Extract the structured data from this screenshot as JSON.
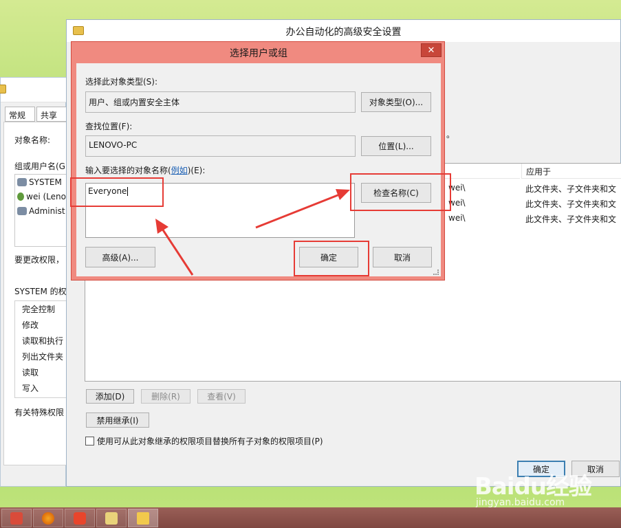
{
  "background_window": {
    "tabs": [
      "常规",
      "共享"
    ],
    "object_name_label": "对象名称:",
    "groups_label": "组或用户名(G",
    "users": [
      "SYSTEM",
      "wei (Leno",
      "Administ"
    ],
    "change_perm_text": "要更改权限，",
    "perm_header": "SYSTEM 的权",
    "permissions": [
      "完全控制",
      "修改",
      "读取和执行",
      "列出文件夹",
      "读取",
      "写入"
    ],
    "special_text": "有关特殊权限"
  },
  "main_window": {
    "title": "办公自动化的高级安全设置",
    "col_applies_to": "应用于",
    "rows": [
      {
        "principal": "wei\\",
        "applies": "此文件夹、子文件夹和文"
      },
      {
        "principal": "wei\\",
        "applies": "此文件夹、子文件夹和文"
      },
      {
        "principal": "wei\\",
        "applies": "此文件夹、子文件夹和文"
      }
    ],
    "dot_text": "。",
    "add_label": "添加(D)",
    "remove_label": "删除(R)",
    "view_label": "查看(V)",
    "disable_inherit_label": "禁用继承(I)",
    "replace_checkbox_label": "使用可从此对象继承的权限项目替换所有子对象的权限项目(P)",
    "ok_label": "确定",
    "cancel_label": "取消"
  },
  "dialog": {
    "title": "选择用户或组",
    "close_glyph": "✕",
    "object_type_label": "选择此对象类型(S):",
    "object_type_value": "用户、组或内置安全主体",
    "object_type_button": "对象类型(O)...",
    "location_label": "查找位置(F):",
    "location_value": "LENOVO-PC",
    "location_button": "位置(L)...",
    "enter_names_label_prefix": "输入要选择的对象名称(",
    "enter_names_link": "例如",
    "enter_names_label_suffix": ")(E):",
    "names_value": "Everyone",
    "check_names_button": "检查名称(C)",
    "advanced_button": "高级(A)...",
    "ok_button": "确定",
    "cancel_button": "取消"
  },
  "watermark": {
    "logo": "Baidu经验",
    "url": "jingyan.baidu.com"
  },
  "colors": {
    "highlight": "#e63b35",
    "dialog_border": "#f08a80"
  }
}
